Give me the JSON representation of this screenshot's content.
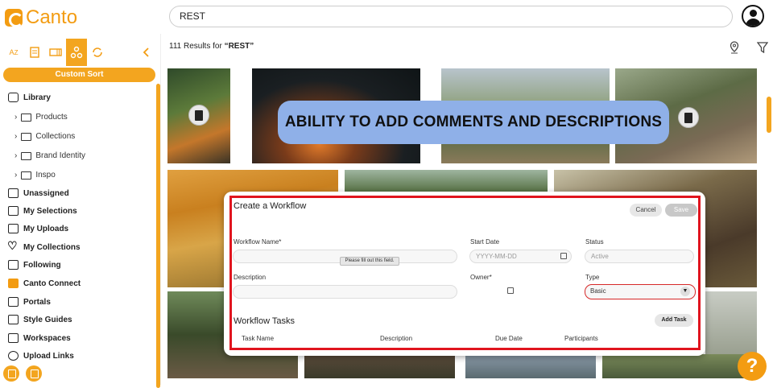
{
  "app": {
    "logo_text": "Canto",
    "brand_color": "#f39c12"
  },
  "search": {
    "value": "REST"
  },
  "toolbar": {
    "sort_az_label": "A",
    "sort_az_sub": "Z",
    "custom_sort_label": "Custom Sort"
  },
  "sidebar": {
    "library_label": "Library",
    "library_children": [
      "Products",
      "Collections",
      "Brand Identity",
      "Inspo"
    ],
    "items": [
      {
        "label": "Unassigned",
        "icon": "unassigned-icon"
      },
      {
        "label": "My Selections",
        "icon": "selections-icon"
      },
      {
        "label": "My Uploads",
        "icon": "upload-icon"
      },
      {
        "label": "My Collections",
        "icon": "heart-icon"
      },
      {
        "label": "Following",
        "icon": "following-icon"
      },
      {
        "label": "Canto Connect",
        "icon": "canto-connect-icon"
      },
      {
        "label": "Portals",
        "icon": "portal-icon"
      },
      {
        "label": "Style Guides",
        "icon": "style-guide-icon"
      },
      {
        "label": "Workspaces",
        "icon": "workspace-icon"
      },
      {
        "label": "Upload Links",
        "icon": "globe-icon"
      }
    ]
  },
  "results": {
    "count": "111",
    "prefix": "Results for",
    "query": "“REST”"
  },
  "banner": {
    "text": "ABILITY TO ADD COMMENTS AND DESCRIPTIONS",
    "color": "#8fb0e8"
  },
  "workflow": {
    "title": "Create a Workflow",
    "cancel_label": "Cancel",
    "save_label": "Save",
    "name_label": "Workflow Name*",
    "start_date_label": "Start Date",
    "start_date_placeholder": "YYYY-MM-DD",
    "status_label": "Status",
    "status_value": "Active",
    "tooltip": "Please fill out this field.",
    "description_label": "Description",
    "owner_label": "Owner*",
    "type_label": "Type",
    "type_value": "Basic",
    "tasks_title": "Workflow Tasks",
    "add_task_label": "Add Task",
    "columns": [
      "Task Name",
      "Description",
      "Due Date",
      "Participants"
    ],
    "highlight_color": "#e0141e"
  },
  "help": {
    "label": "?"
  }
}
